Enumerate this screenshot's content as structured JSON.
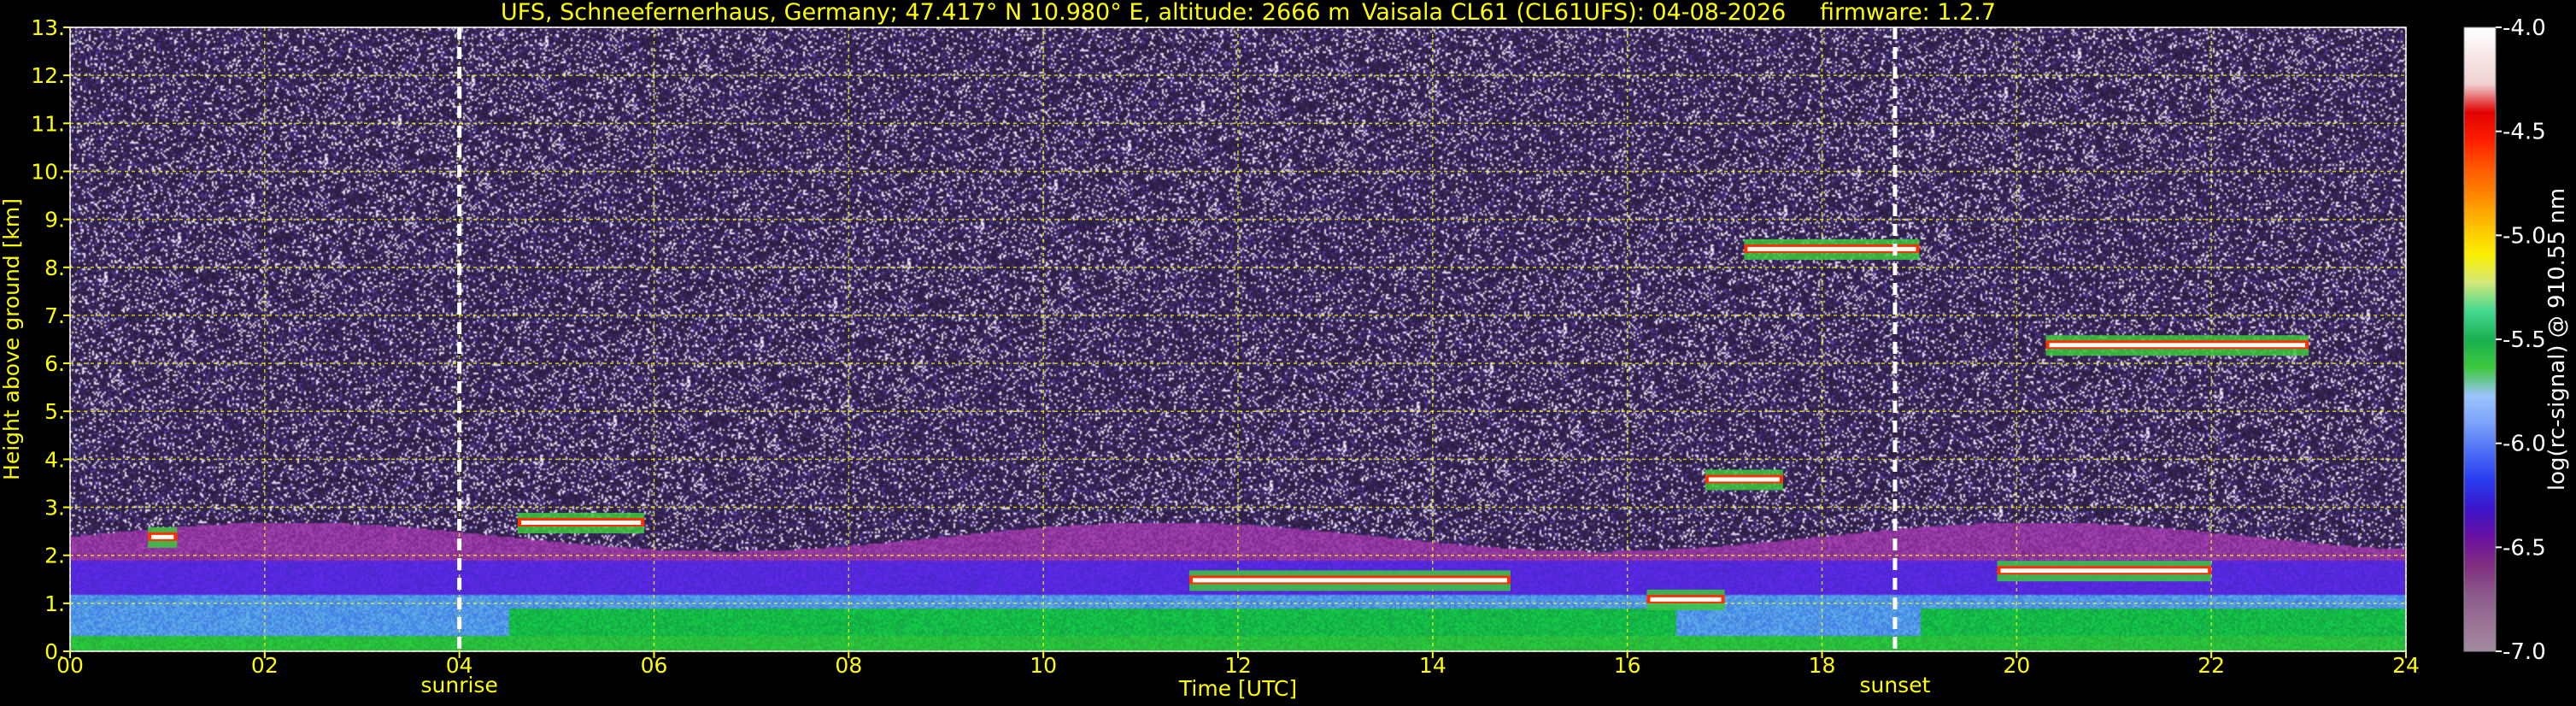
{
  "chart_data": {
    "type": "heatmap",
    "title_parts": {
      "site": "UFS, Schneefernerhaus, Germany; 47.417° N 10.980° E, altitude: 2666 m",
      "instrument": "Vaisala CL61 (CL61UFS): 04-08-2026",
      "firmware": "firmware: 1.2.7"
    },
    "xlabel": "Time [UTC]",
    "ylabel": "Height above ground [km]",
    "x_ticks": [
      "00",
      "02",
      "04",
      "06",
      "08",
      "10",
      "12",
      "14",
      "16",
      "18",
      "20",
      "22",
      "24"
    ],
    "x_tick_values": [
      0,
      2,
      4,
      6,
      8,
      10,
      12,
      14,
      16,
      18,
      20,
      22,
      24
    ],
    "xlim": [
      0,
      24
    ],
    "y_ticks": [
      "0.",
      "1.",
      "2.",
      "3.",
      "4.",
      "5.",
      "6.",
      "7.",
      "8.",
      "9.",
      "10.",
      "11.",
      "12.",
      "13."
    ],
    "y_tick_values": [
      0,
      1,
      2,
      3,
      4,
      5,
      6,
      7,
      8,
      9,
      10,
      11,
      12,
      13
    ],
    "ylim": [
      0,
      13
    ],
    "grid": true,
    "grid_color": "#ffff00",
    "vertical_markers": [
      {
        "label": "sunrise",
        "time": 4.0
      },
      {
        "label": "sunset",
        "time": 18.75
      }
    ],
    "colorbar": {
      "label": "log(rc-signal) @ 910.55 nm",
      "ticks": [
        "-4.0",
        "-4.5",
        "-5.0",
        "-5.5",
        "-6.0",
        "-6.5",
        "-7.0"
      ],
      "tick_values": [
        -4.0,
        -4.5,
        -5.0,
        -5.5,
        -6.0,
        -6.5,
        -7.0
      ],
      "range": [
        -7.0,
        -4.0
      ],
      "colors": [
        "#a08aa0",
        "#9c7496",
        "#8a5a8a",
        "#80307e",
        "#6a10a0",
        "#3b14c8",
        "#2a3af0",
        "#4a6cf5",
        "#7aa0fa",
        "#9cc4fc",
        "#3cc83c",
        "#18b050",
        "#44d890",
        "#d4e87a",
        "#fcf000",
        "#fcc000",
        "#ff8a00",
        "#ff5a00",
        "#ff2000",
        "#e00000",
        "#f0d0d0",
        "#f8e8e8",
        "#ffffff"
      ]
    },
    "features": [
      {
        "name": "boundary-layer aerosol",
        "t_start": 0,
        "t_end": 24,
        "base_km": 0.0,
        "top_km": 2.5
      },
      {
        "name": "cloud",
        "t_start": 0.8,
        "t_end": 1.1,
        "height_km": 2.3
      },
      {
        "name": "cloud",
        "t_start": 4.6,
        "t_end": 5.9,
        "height_km": 2.6
      },
      {
        "name": "cloud",
        "t_start": 11.5,
        "t_end": 14.8,
        "height_km": 1.4
      },
      {
        "name": "cloud",
        "t_start": 16.2,
        "t_end": 17.0,
        "height_km": 1.0
      },
      {
        "name": "cloud",
        "t_start": 16.8,
        "t_end": 17.6,
        "height_km": 3.5
      },
      {
        "name": "cloud",
        "t_start": 17.2,
        "t_end": 19.0,
        "height_km": 8.3
      },
      {
        "name": "cloud",
        "t_start": 19.8,
        "t_end": 22.0,
        "height_km": 1.6
      },
      {
        "name": "cloud",
        "t_start": 20.3,
        "t_end": 23.0,
        "height_km": 6.3
      }
    ]
  }
}
